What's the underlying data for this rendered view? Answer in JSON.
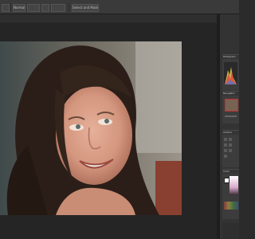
{
  "options_bar": {
    "mode_select": "Normal",
    "control_2": "",
    "control_3": "",
    "control_4": "",
    "select_mask": "Select and Mask..."
  },
  "panels": {
    "histogram": {
      "title": "Histogram"
    },
    "navigator": {
      "title": "Navigator"
    },
    "actions": {
      "title": "Actions"
    },
    "color": {
      "title": "Color"
    }
  },
  "colors": {
    "app_bg": "#2b2b2b",
    "canvas_bg": "#252525",
    "panel_bg": "#3c3c3c",
    "histogram_red": "#e04040",
    "histogram_yellow": "#e8c84a",
    "histogram_blue": "#4a7ad8"
  }
}
